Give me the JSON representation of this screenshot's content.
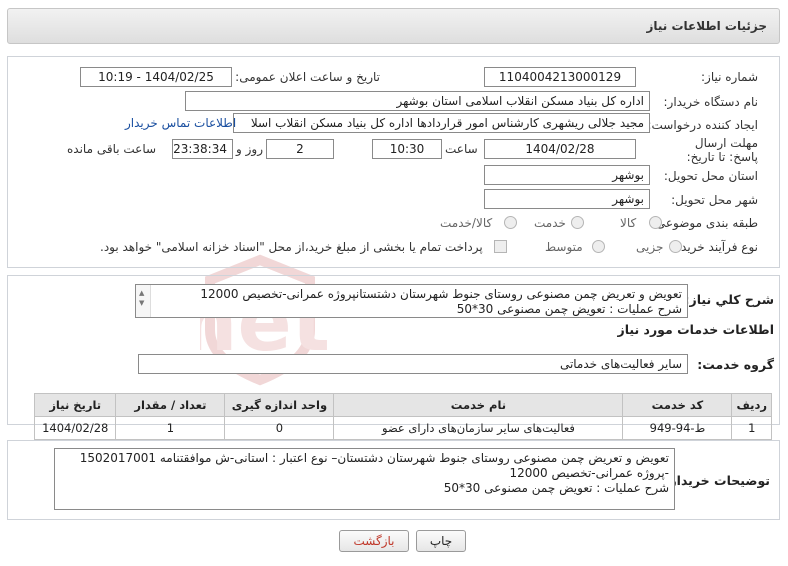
{
  "header": {
    "title": "جزئیات اطلاعات نیاز"
  },
  "form": {
    "need_number": {
      "label": "شماره نیاز:",
      "value": "1104004213000129"
    },
    "announce_datetime": {
      "label": "تاریخ و ساعت اعلان عمومی:",
      "value": "1404/02/25 - 10:19"
    },
    "buyer_org": {
      "label": "نام دستگاه خریدار:",
      "value": "اداره کل بنیاد مسکن انقلاب اسلامی استان بوشهر"
    },
    "requester": {
      "label": "ایجاد کننده درخواست:",
      "value": "مجید جلالی ریشهری کارشناس امور قراردادها اداره کل بنیاد مسکن انقلاب اسلا",
      "link": "اطلاعات تماس خریدار"
    },
    "deadline": {
      "label": "مهلت ارسال پاسخ: تا تاریخ:",
      "date": "1404/02/28",
      "time_label": "ساعت",
      "time": "10:30",
      "days": "2",
      "days_label": "روز و",
      "remaining": "23:38:34",
      "remaining_label": "ساعت باقی مانده"
    },
    "province": {
      "label": "استان محل تحویل:",
      "value": "بوشهر"
    },
    "city": {
      "label": "شهر محل تحویل:",
      "value": "بوشهر"
    },
    "category": {
      "label": "طبقه بندی موضوعی:",
      "options": [
        "کالا",
        "خدمت",
        "کالا/خدمت"
      ]
    },
    "purchase_type": {
      "label": "نوع فرآیند خرید :",
      "options": [
        "جزیی",
        "متوسط"
      ],
      "payment_note": "پرداخت تمام یا بخشی از مبلغ خرید،از محل \"اسناد خزانه اسلامی\" خواهد بود."
    }
  },
  "need_desc": {
    "label": "شرح کلي نياز:",
    "line1": "تعویض و تعریض چمن مصنوعی روستای جنوط  شهرستان دشتستانپروژه عمرانی-تخصیص 12000",
    "line2": "شرح عملیات : تعویض چمن مصنوعی 30*50"
  },
  "services": {
    "section_title": "اطلاعات خدمات مورد نیاز",
    "group_label": "گروه خدمت:",
    "group_value": "سایر فعالیت‌های خدماتی",
    "columns": [
      "ردیف",
      "کد خدمت",
      "نام خدمت",
      "واحد اندازه گیری",
      "تعداد / مقدار",
      "تاریخ نیاز"
    ],
    "rows": [
      [
        "1",
        "ط-94-949",
        "فعالیت‌های سایر سازمان‌های دارای عضو",
        "0",
        "1",
        "1404/02/28"
      ]
    ]
  },
  "buyer_notes": {
    "label": "توضیحات خریدار:",
    "line1": "تعویض و تعریض چمن مصنوعی روستای جنوط  شهرستان دشتستان– نوع اعتبار : استانی-ش موافقتنامه 1502017001",
    "line2": "-پروژه عمرانی-تخصیص 12000",
    "line3": "شرح عملیات : تعویض چمن مصنوعی 30*50"
  },
  "buttons": {
    "print": "چاپ",
    "back": "بازگشت"
  },
  "watermark": "AriaTender.net",
  "colors": {
    "link": "#1a4fa0",
    "back_text": "#c0392b",
    "watermark": "#e9b8b8"
  }
}
